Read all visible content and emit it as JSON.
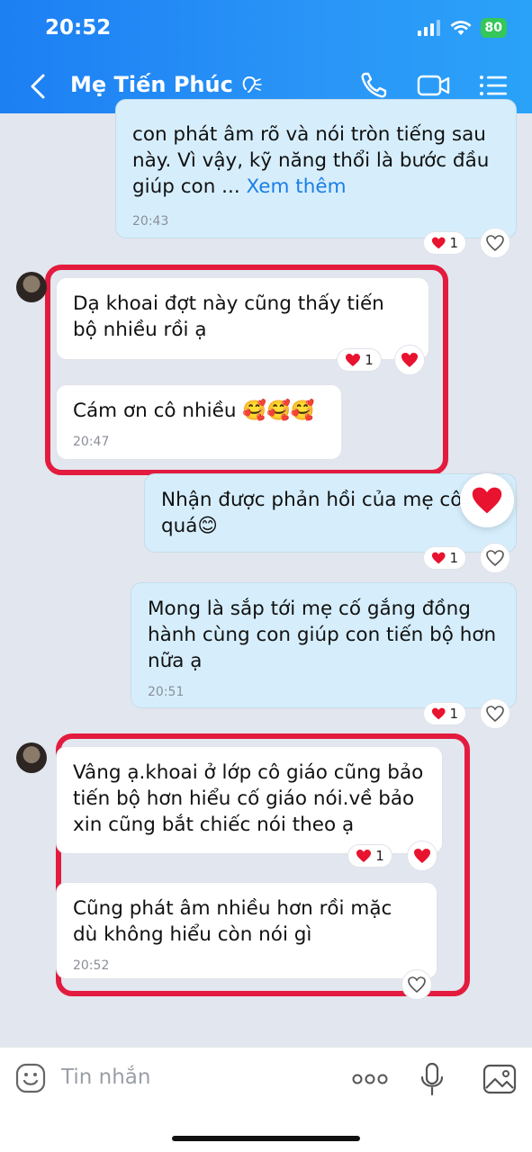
{
  "status": {
    "time": "20:52",
    "battery": "80"
  },
  "header": {
    "contact_name": "Mẹ Tiến Phúc"
  },
  "messages": [
    {
      "id": "m1",
      "direction": "out",
      "text": "con phát âm rõ và nói tròn tiếng sau này. Vì vậy, kỹ năng thổi là bước đầu giúp con ... ",
      "more": "Xem thêm",
      "time": "20:43",
      "reaction_count": "1"
    },
    {
      "id": "m2",
      "direction": "in",
      "text": "Dạ khoai đợt này cũng thấy tiến bộ nhiều rồi ạ",
      "reaction_count": "1"
    },
    {
      "id": "m3",
      "direction": "in",
      "text": "Cám ơn cô nhiều 🥰🥰🥰",
      "time": "20:47"
    },
    {
      "id": "m4",
      "direction": "out",
      "text": "Nhận được phản hồi của mẹ cô quá😊",
      "reaction_count": "1"
    },
    {
      "id": "m5",
      "direction": "out",
      "text": "Mong là sắp tới mẹ cố gắng đồng hành cùng con giúp con tiến bộ hơn nữa ạ",
      "time": "20:51",
      "reaction_count": "1"
    },
    {
      "id": "m6",
      "direction": "in",
      "text": "Vâng ạ.khoai ở lớp cô giáo cũng bảo tiến bộ hơn hiểu cố giáo nói.về bảo xin cũng bắt chiếc nói theo ạ",
      "reaction_count": "1"
    },
    {
      "id": "m7",
      "direction": "in",
      "text": "Cũng phát âm nhiều hơn rồi mặc dù không hiểu còn nói gì",
      "time": "20:52"
    }
  ],
  "input": {
    "placeholder": "Tin nhắn"
  },
  "colors": {
    "header_blue": "#1c7ff3",
    "outgoing_bubble": "#d6eefc",
    "incoming_bubble": "#ffffff",
    "highlight_red": "#e31b3e",
    "heart_red": "#e8132e"
  }
}
